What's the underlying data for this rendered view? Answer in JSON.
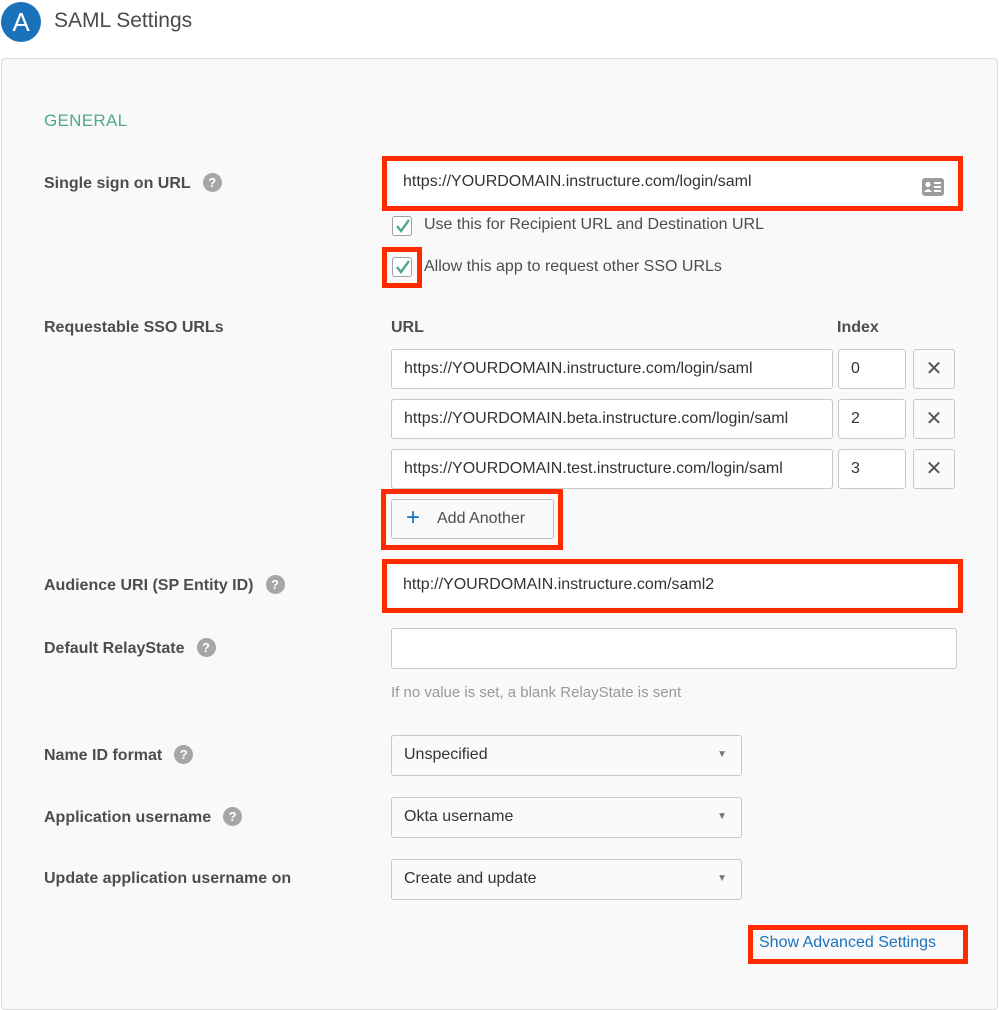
{
  "header": {
    "logo_letter": "A",
    "title": "SAML Settings"
  },
  "colors": {
    "accent_blue": "#1a72bb",
    "section_green": "#4eaa87",
    "highlight_red": "#ff2a00"
  },
  "section": {
    "title": "GENERAL"
  },
  "fields": {
    "single_sign_on_url": {
      "label": "Single sign on URL",
      "help": "?",
      "value": "https://YOURDOMAIN.instructure.com/login/saml",
      "icon": "contact-card-icon"
    },
    "use_for_recipient": {
      "label": "Use this for Recipient URL and Destination URL",
      "checked": true
    },
    "allow_other_sso": {
      "label": "Allow this app to request other SSO URLs",
      "checked": true
    },
    "requestable_sso_urls": {
      "label": "Requestable SSO URLs",
      "url_header": "URL",
      "index_header": "Index",
      "rows": [
        {
          "url": "https://YOURDOMAIN.instructure.com/login/saml",
          "index": "0"
        },
        {
          "url": "https://YOURDOMAIN.beta.instructure.com/login/saml",
          "index": "2"
        },
        {
          "url": "https://YOURDOMAIN.test.instructure.com/login/saml",
          "index": "3"
        }
      ],
      "remove_symbol": "✕",
      "add_button_label": "Add Another",
      "add_symbol": "+"
    },
    "audience_uri": {
      "label": "Audience URI (SP Entity ID)",
      "help": "?",
      "value": "http://YOURDOMAIN.instructure.com/saml2"
    },
    "default_relay_state": {
      "label": "Default RelayState",
      "help": "?",
      "value": "",
      "hint": "If no value is set, a blank RelayState is sent"
    },
    "name_id_format": {
      "label": "Name ID format",
      "help": "?",
      "selected": "Unspecified"
    },
    "application_username": {
      "label": "Application username",
      "help": "?",
      "selected": "Okta username"
    },
    "update_username_on": {
      "label": "Update application username on",
      "selected": "Create and update"
    }
  },
  "advanced_link": "Show Advanced Settings",
  "caret_symbol": "▼"
}
